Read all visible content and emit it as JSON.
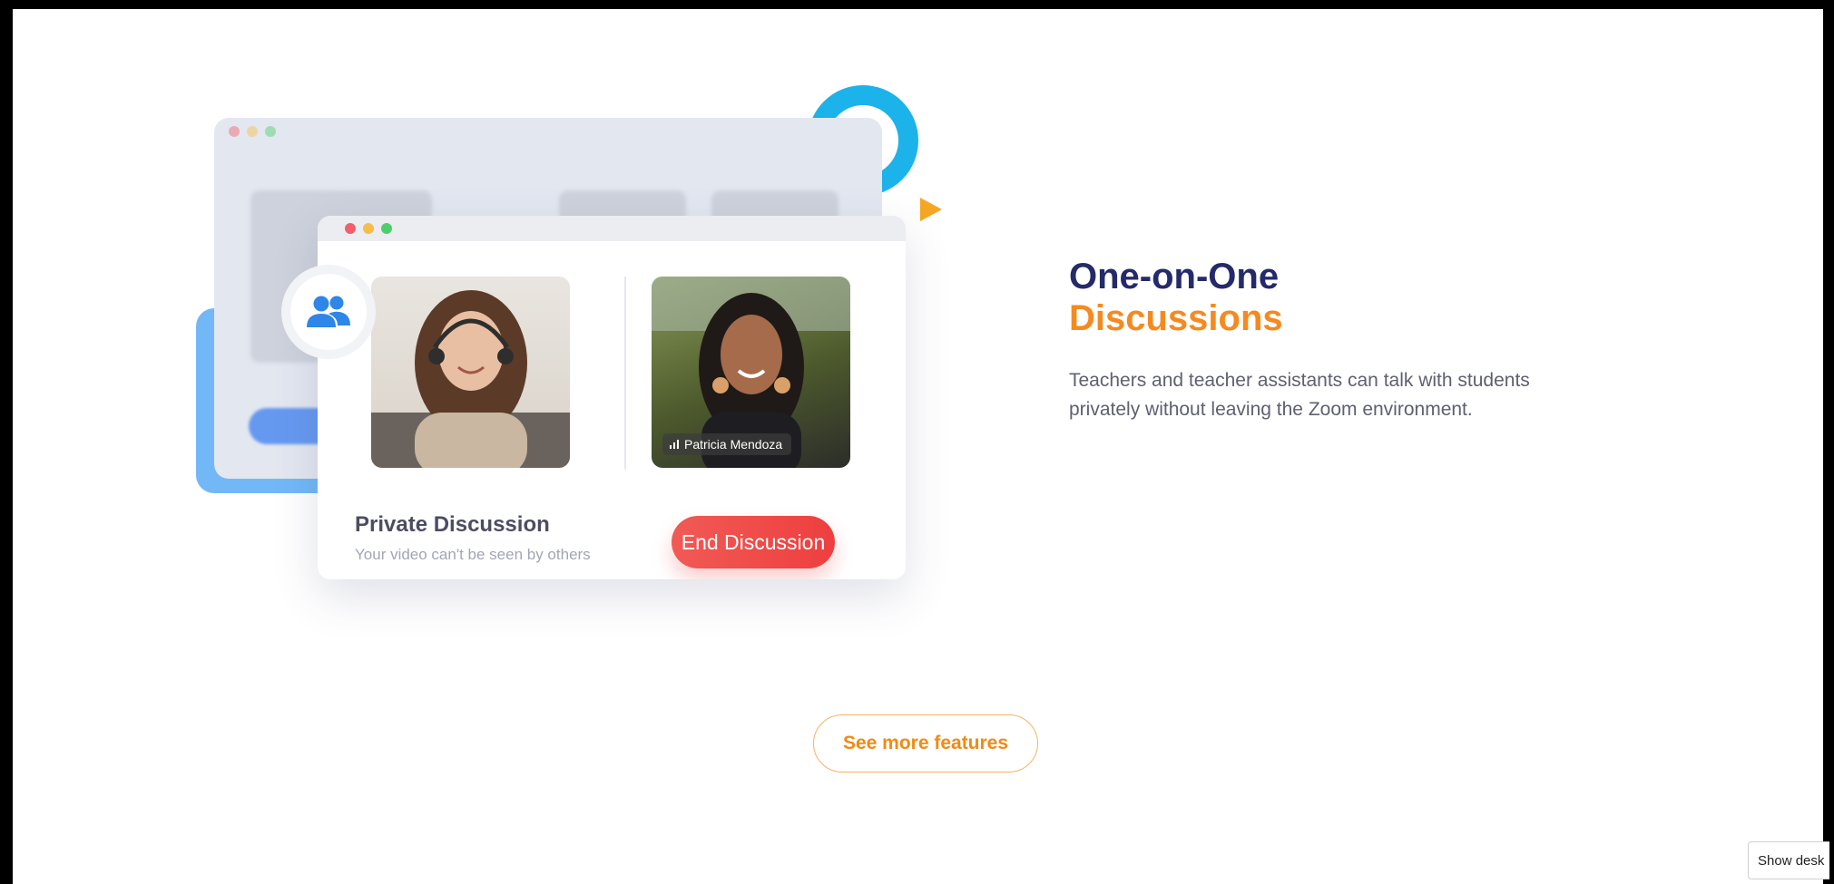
{
  "colors": {
    "heading_primary": "#242a6a",
    "heading_accent": "#f58a1f",
    "end_button": "#ef4a48",
    "ring": "#1bb3ea",
    "triangle": "#f6a623",
    "blue_block": "#72b8f7"
  },
  "illustration": {
    "participant_name": "Patricia Mendoza",
    "private_title": "Private Discussion",
    "private_subtitle": "Your video can't be seen by others",
    "end_button_label": "End Discussion",
    "badge_icon": "users-icon"
  },
  "feature": {
    "title_line1": "One-on-One",
    "title_line2": "Discussions",
    "description": "Teachers and teacher assistants can talk with students privately without leaving the Zoom environment."
  },
  "cta": {
    "see_more_label": "See more features"
  },
  "taskbar": {
    "show_desktop_label": "Show desk"
  }
}
